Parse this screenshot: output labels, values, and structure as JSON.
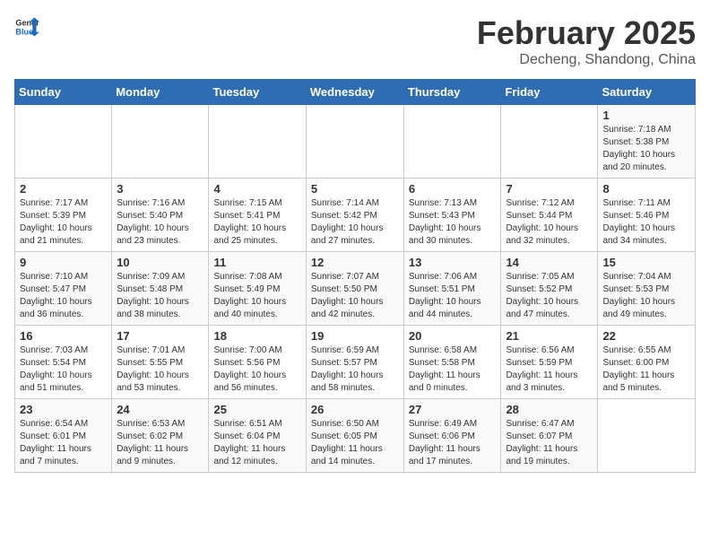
{
  "header": {
    "logo_general": "General",
    "logo_blue": "Blue",
    "title": "February 2025",
    "subtitle": "Decheng, Shandong, China"
  },
  "weekdays": [
    "Sunday",
    "Monday",
    "Tuesday",
    "Wednesday",
    "Thursday",
    "Friday",
    "Saturday"
  ],
  "weeks": [
    [
      {
        "day": "",
        "info": ""
      },
      {
        "day": "",
        "info": ""
      },
      {
        "day": "",
        "info": ""
      },
      {
        "day": "",
        "info": ""
      },
      {
        "day": "",
        "info": ""
      },
      {
        "day": "",
        "info": ""
      },
      {
        "day": "1",
        "info": "Sunrise: 7:18 AM\nSunset: 5:38 PM\nDaylight: 10 hours\nand 20 minutes."
      }
    ],
    [
      {
        "day": "2",
        "info": "Sunrise: 7:17 AM\nSunset: 5:39 PM\nDaylight: 10 hours\nand 21 minutes."
      },
      {
        "day": "3",
        "info": "Sunrise: 7:16 AM\nSunset: 5:40 PM\nDaylight: 10 hours\nand 23 minutes."
      },
      {
        "day": "4",
        "info": "Sunrise: 7:15 AM\nSunset: 5:41 PM\nDaylight: 10 hours\nand 25 minutes."
      },
      {
        "day": "5",
        "info": "Sunrise: 7:14 AM\nSunset: 5:42 PM\nDaylight: 10 hours\nand 27 minutes."
      },
      {
        "day": "6",
        "info": "Sunrise: 7:13 AM\nSunset: 5:43 PM\nDaylight: 10 hours\nand 30 minutes."
      },
      {
        "day": "7",
        "info": "Sunrise: 7:12 AM\nSunset: 5:44 PM\nDaylight: 10 hours\nand 32 minutes."
      },
      {
        "day": "8",
        "info": "Sunrise: 7:11 AM\nSunset: 5:46 PM\nDaylight: 10 hours\nand 34 minutes."
      }
    ],
    [
      {
        "day": "9",
        "info": "Sunrise: 7:10 AM\nSunset: 5:47 PM\nDaylight: 10 hours\nand 36 minutes."
      },
      {
        "day": "10",
        "info": "Sunrise: 7:09 AM\nSunset: 5:48 PM\nDaylight: 10 hours\nand 38 minutes."
      },
      {
        "day": "11",
        "info": "Sunrise: 7:08 AM\nSunset: 5:49 PM\nDaylight: 10 hours\nand 40 minutes."
      },
      {
        "day": "12",
        "info": "Sunrise: 7:07 AM\nSunset: 5:50 PM\nDaylight: 10 hours\nand 42 minutes."
      },
      {
        "day": "13",
        "info": "Sunrise: 7:06 AM\nSunset: 5:51 PM\nDaylight: 10 hours\nand 44 minutes."
      },
      {
        "day": "14",
        "info": "Sunrise: 7:05 AM\nSunset: 5:52 PM\nDaylight: 10 hours\nand 47 minutes."
      },
      {
        "day": "15",
        "info": "Sunrise: 7:04 AM\nSunset: 5:53 PM\nDaylight: 10 hours\nand 49 minutes."
      }
    ],
    [
      {
        "day": "16",
        "info": "Sunrise: 7:03 AM\nSunset: 5:54 PM\nDaylight: 10 hours\nand 51 minutes."
      },
      {
        "day": "17",
        "info": "Sunrise: 7:01 AM\nSunset: 5:55 PM\nDaylight: 10 hours\nand 53 minutes."
      },
      {
        "day": "18",
        "info": "Sunrise: 7:00 AM\nSunset: 5:56 PM\nDaylight: 10 hours\nand 56 minutes."
      },
      {
        "day": "19",
        "info": "Sunrise: 6:59 AM\nSunset: 5:57 PM\nDaylight: 10 hours\nand 58 minutes."
      },
      {
        "day": "20",
        "info": "Sunrise: 6:58 AM\nSunset: 5:58 PM\nDaylight: 11 hours\nand 0 minutes."
      },
      {
        "day": "21",
        "info": "Sunrise: 6:56 AM\nSunset: 5:59 PM\nDaylight: 11 hours\nand 3 minutes."
      },
      {
        "day": "22",
        "info": "Sunrise: 6:55 AM\nSunset: 6:00 PM\nDaylight: 11 hours\nand 5 minutes."
      }
    ],
    [
      {
        "day": "23",
        "info": "Sunrise: 6:54 AM\nSunset: 6:01 PM\nDaylight: 11 hours\nand 7 minutes."
      },
      {
        "day": "24",
        "info": "Sunrise: 6:53 AM\nSunset: 6:02 PM\nDaylight: 11 hours\nand 9 minutes."
      },
      {
        "day": "25",
        "info": "Sunrise: 6:51 AM\nSunset: 6:04 PM\nDaylight: 11 hours\nand 12 minutes."
      },
      {
        "day": "26",
        "info": "Sunrise: 6:50 AM\nSunset: 6:05 PM\nDaylight: 11 hours\nand 14 minutes."
      },
      {
        "day": "27",
        "info": "Sunrise: 6:49 AM\nSunset: 6:06 PM\nDaylight: 11 hours\nand 17 minutes."
      },
      {
        "day": "28",
        "info": "Sunrise: 6:47 AM\nSunset: 6:07 PM\nDaylight: 11 hours\nand 19 minutes."
      },
      {
        "day": "",
        "info": ""
      }
    ]
  ]
}
